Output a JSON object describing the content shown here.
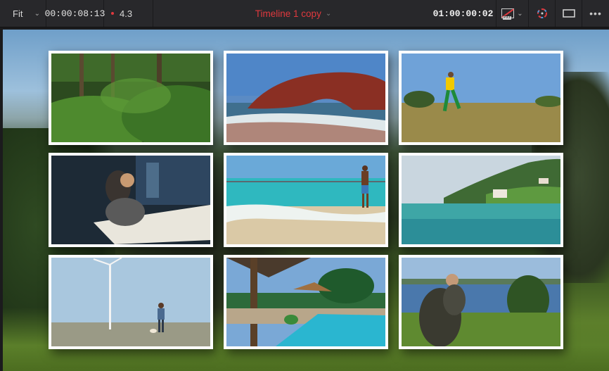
{
  "toolbar": {
    "zoom_label": "Fit",
    "timecode": "00:00:08:13",
    "speed": "4.3",
    "timeline_title": "Timeline 1 copy",
    "end_timecode": "01:00:00:02",
    "icons": [
      "chevron-down-icon",
      "proxy-icon",
      "color-wheel-icon",
      "viewer-layout-icon",
      "more-icon"
    ]
  },
  "viewer": {
    "grid": [
      {
        "name": "forest-clip"
      },
      {
        "name": "coastal-rock-arch-clip"
      },
      {
        "name": "runner-in-meadow-clip"
      },
      {
        "name": "architects-at-drafting-table-clip"
      },
      {
        "name": "man-on-beach-clip"
      },
      {
        "name": "lake-and-hillside-clip"
      },
      {
        "name": "wind-turbine-walker-clip"
      },
      {
        "name": "tropical-resort-pool-clip"
      },
      {
        "name": "hiker-overlooking-lake-clip"
      }
    ]
  }
}
